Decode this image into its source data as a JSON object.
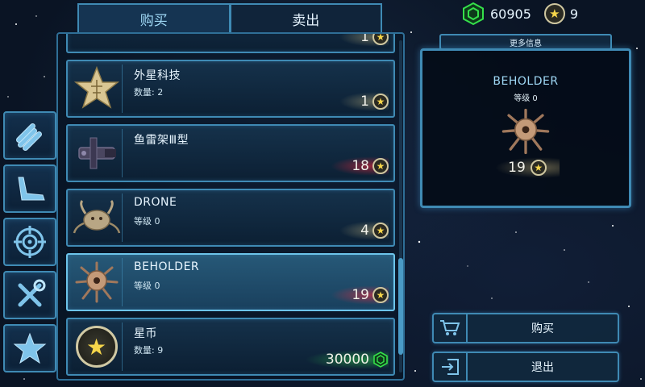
{
  "tabs": {
    "buy": "购买",
    "sell": "卖出"
  },
  "currency": {
    "crystals": "60905",
    "stars": "9"
  },
  "more_info": {
    "label": "更多信息",
    "name": "BEHOLDER",
    "level": "等级 0",
    "price": "19"
  },
  "items": [
    {
      "name": "外星科技",
      "sub": "数量: 2",
      "price": "1",
      "currency": "star",
      "glow": "gold"
    },
    {
      "name": "鱼雷架Ⅲ型",
      "sub": "",
      "price": "18",
      "currency": "star",
      "glow": "red"
    },
    {
      "name": "DRONE",
      "sub": "等级 0",
      "price": "4",
      "currency": "star",
      "glow": "gold"
    },
    {
      "name": "BEHOLDER",
      "sub": "等级 0",
      "price": "19",
      "currency": "star",
      "glow": "red",
      "selected": true
    },
    {
      "name": "星币",
      "sub": "数量: 9",
      "price": "30000",
      "currency": "crystal",
      "glow": "green"
    }
  ],
  "partial_item_price": "1",
  "buttons": {
    "buy": "购买",
    "exit": "退出"
  },
  "colors": {
    "accent": "#3f8ab4",
    "highlight": "#9fd8f5",
    "gold": "#f6d64a",
    "crystal": "#35e04a",
    "red_glow": "#ff2838"
  },
  "icons": {
    "categories": [
      "missiles-icon",
      "wing-icon",
      "target-icon",
      "tools-icon",
      "star-icon"
    ],
    "buy": "cart-icon",
    "exit": "exit-icon"
  }
}
